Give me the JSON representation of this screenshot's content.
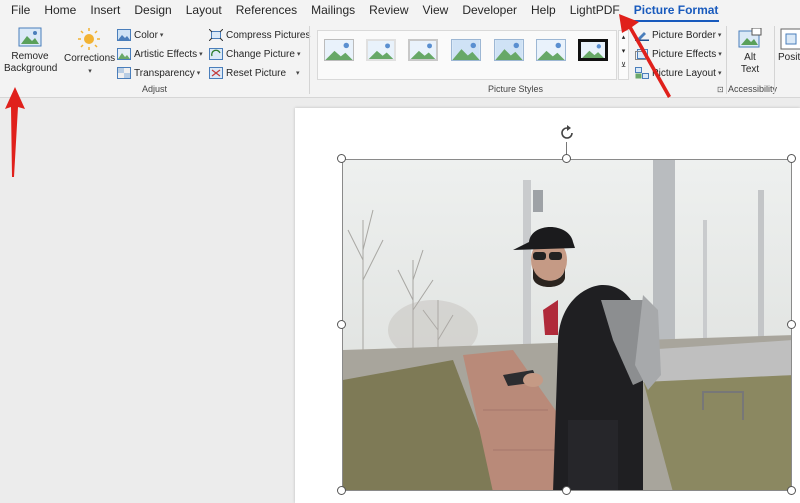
{
  "menu": {
    "tabs": [
      "File",
      "Home",
      "Insert",
      "Design",
      "Layout",
      "References",
      "Mailings",
      "Review",
      "View",
      "Developer",
      "Help",
      "LightPDF",
      "Picture Format"
    ],
    "active": "Picture Format"
  },
  "ribbon": {
    "remove_background_line1": "Remove",
    "remove_background_line2": "Background",
    "corrections": "Corrections",
    "color": "Color",
    "artistic_effects": "Artistic Effects",
    "transparency": "Transparency",
    "compress_pictures": "Compress Pictures",
    "change_picture": "Change Picture",
    "reset_picture": "Reset Picture",
    "adjust_group": "Adjust",
    "picture_styles_group": "Picture Styles",
    "picture_border": "Picture Border",
    "picture_effects": "Picture Effects",
    "picture_layout": "Picture Layout",
    "alt_text_line1": "Alt",
    "alt_text_line2": "Text",
    "accessibility_group": "Accessibility",
    "position_partial": "Positi"
  },
  "colors": {
    "accent": "#185abd",
    "annotation_arrow": "#e0201b"
  }
}
